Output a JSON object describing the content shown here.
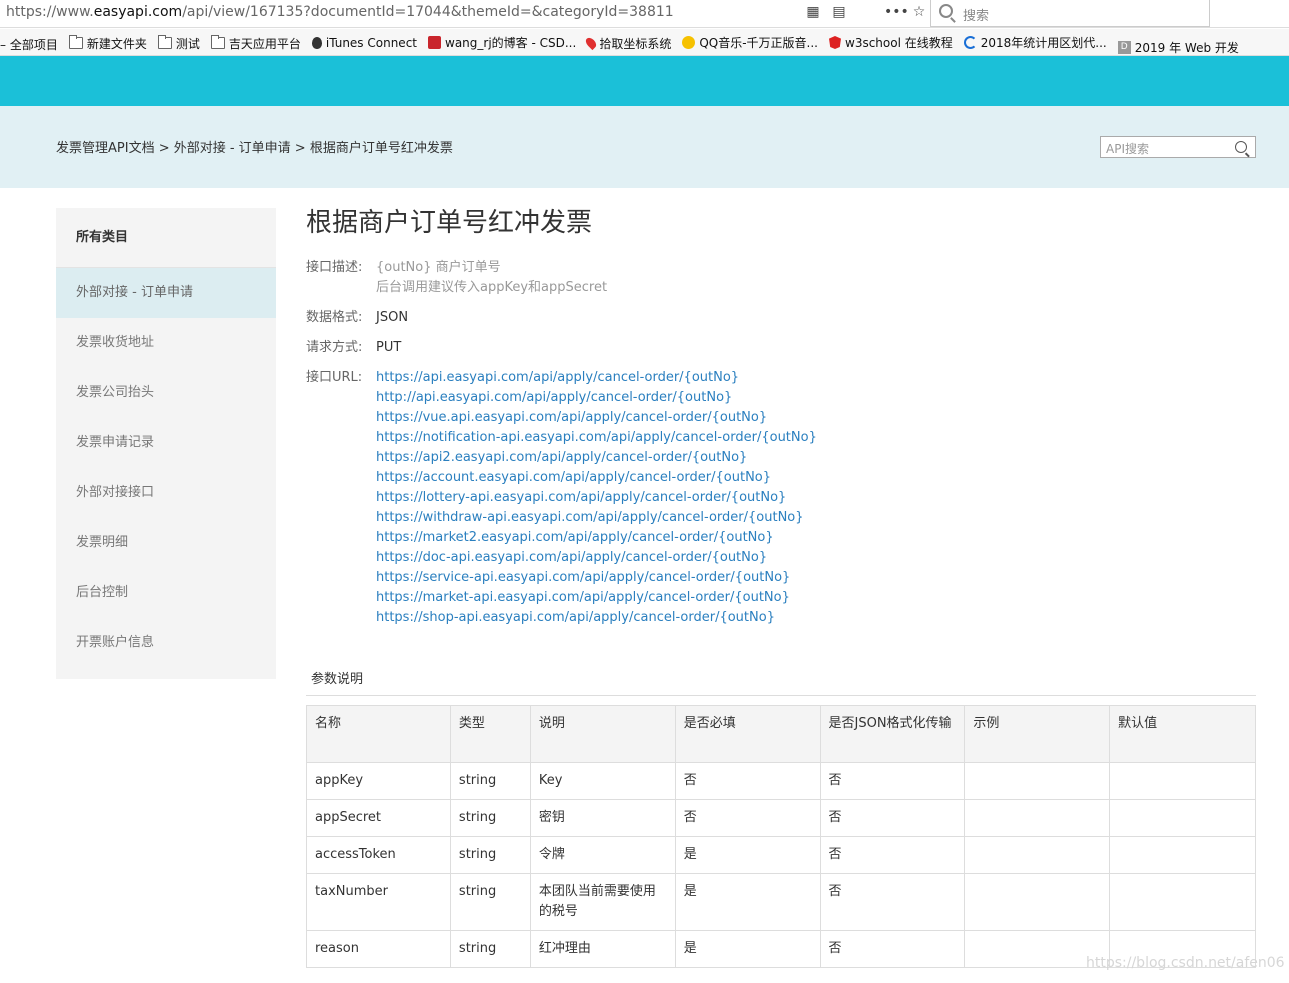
{
  "browser": {
    "url_prefix": "https://www.",
    "url_domain": "easyapi.com",
    "url_rest": "/api/view/167135?documentId=17044&themeId=&categoryId=38811",
    "search_placeholder": "搜索",
    "bookmarks": [
      {
        "label": "– 全部项目",
        "icon": "none"
      },
      {
        "label": "新建文件夹",
        "icon": "folder"
      },
      {
        "label": "测试",
        "icon": "folder"
      },
      {
        "label": "吉天应用平台",
        "icon": "folder"
      },
      {
        "label": "iTunes Connect",
        "icon": "apple"
      },
      {
        "label": "wang_rj的博客 - CSD...",
        "icon": "csdn"
      },
      {
        "label": "拾取坐标系统",
        "icon": "pin"
      },
      {
        "label": "QQ音乐-千万正版音...",
        "icon": "qq"
      },
      {
        "label": "w3school 在线教程",
        "icon": "w3"
      },
      {
        "label": "2018年统计用区划代...",
        "icon": "stat"
      },
      {
        "label": "2019 年 Web 开发",
        "icon": "doc"
      }
    ]
  },
  "breadcrumb": "发票管理API文档 > 外部对接 - 订单申请 > 根据商户订单号红冲发票",
  "api_search_placeholder": "API搜索",
  "sidebar": {
    "header": "所有类目",
    "items": [
      {
        "label": "外部对接 - 订单申请",
        "active": true
      },
      {
        "label": "发票收货地址"
      },
      {
        "label": "发票公司抬头"
      },
      {
        "label": "发票申请记录"
      },
      {
        "label": "外部对接接口"
      },
      {
        "label": "发票明细"
      },
      {
        "label": "后台控制"
      },
      {
        "label": "开票账户信息"
      }
    ]
  },
  "page": {
    "title": "根据商户订单号红冲发票",
    "desc_label": "接口描述:",
    "desc_line1": "{outNo} 商户订单号",
    "desc_line2": "后台调用建议传入appKey和appSecret",
    "format_label": "数据格式:",
    "format_value": "JSON",
    "method_label": "请求方式:",
    "method_value": "PUT",
    "url_label": "接口URL:",
    "urls": [
      "https://api.easyapi.com/api/apply/cancel-order/{outNo}",
      "http://api.easyapi.com/api/apply/cancel-order/{outNo}",
      "https://vue.api.easyapi.com/api/apply/cancel-order/{outNo}",
      "https://notification-api.easyapi.com/api/apply/cancel-order/{outNo}",
      "https://api2.easyapi.com/api/apply/cancel-order/{outNo}",
      "https://account.easyapi.com/api/apply/cancel-order/{outNo}",
      "https://lottery-api.easyapi.com/api/apply/cancel-order/{outNo}",
      "https://withdraw-api.easyapi.com/api/apply/cancel-order/{outNo}",
      "https://market2.easyapi.com/api/apply/cancel-order/{outNo}",
      "https://doc-api.easyapi.com/api/apply/cancel-order/{outNo}",
      "https://service-api.easyapi.com/api/apply/cancel-order/{outNo}",
      "https://market-api.easyapi.com/api/apply/cancel-order/{outNo}",
      "https://shop-api.easyapi.com/api/apply/cancel-order/{outNo}"
    ]
  },
  "params": {
    "title": "参数说明",
    "headers": [
      "名称",
      "类型",
      "说明",
      "是否必填",
      "是否JSON格式化传输",
      "示例",
      "默认值"
    ],
    "rows": [
      [
        "appKey",
        "string",
        "Key",
        "否",
        "否",
        "",
        ""
      ],
      [
        "appSecret",
        "string",
        "密钥",
        "否",
        "否",
        "",
        ""
      ],
      [
        "accessToken",
        "string",
        "令牌",
        "是",
        "否",
        "",
        ""
      ],
      [
        "taxNumber",
        "string",
        "本团队当前需要使用的税号",
        "是",
        "否",
        "",
        ""
      ],
      [
        "reason",
        "string",
        "红冲理由",
        "是",
        "否",
        "",
        ""
      ]
    ]
  },
  "watermark": "https://blog.csdn.net/afen06",
  "colors": {
    "topbar": "#1bc0d8",
    "crumbbar": "#e1f0f4",
    "link": "#2a7fbf"
  }
}
